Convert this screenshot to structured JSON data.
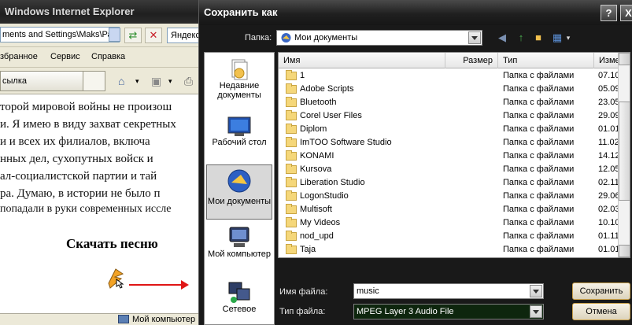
{
  "ie": {
    "title": "Windows Internet Explorer",
    "address": "ments and Settings\\Maks\\Ра",
    "search_text": "Яндекс",
    "menu": [
      "збранное",
      "Сервис",
      "Справка"
    ],
    "tab_label": "сылка",
    "content_lines": [
      "торой мировой войны не произош",
      "и.  Я имею в виду захват секретных",
      "и  и  всех  их  филиалов,  включа",
      "нных  дел,  сухопутных  войск  и",
      "ал-социалистской  партии  и  тай",
      "ра.  Думаю,  в  истории  не  было  п",
      "попадали в руки современных иссле"
    ],
    "heading": "Скачать песню",
    "status": "Мой компьютер"
  },
  "dialog": {
    "title": "Сохранить как",
    "help_label": "?",
    "close_label": "X",
    "folder_label": "Папка:",
    "folder_value": "Мои документы",
    "places": [
      {
        "label": "Недавние документы",
        "icon": "recent-documents-icon"
      },
      {
        "label": "Рабочий стол",
        "icon": "desktop-icon"
      },
      {
        "label": "Мои документы",
        "icon": "my-documents-icon"
      },
      {
        "label": "Мой компьютер",
        "icon": "my-computer-icon"
      },
      {
        "label": "Сетевое",
        "icon": "network-icon"
      }
    ],
    "columns": [
      "Имя",
      "Размер",
      "Тип",
      "Изме"
    ],
    "files": [
      {
        "name": "1",
        "type": "Папка с файлами",
        "date": "07.10"
      },
      {
        "name": "Adobe Scripts",
        "type": "Папка с файлами",
        "date": "05.09"
      },
      {
        "name": "Bluetooth",
        "type": "Папка с файлами",
        "date": "23.05"
      },
      {
        "name": "Corel User Files",
        "type": "Папка с файлами",
        "date": "29.09"
      },
      {
        "name": "Diplom",
        "type": "Папка с файлами",
        "date": "01.01"
      },
      {
        "name": "ImTOO Software Studio",
        "type": "Папка с файлами",
        "date": "11.02"
      },
      {
        "name": "KONAMI",
        "type": "Папка с файлами",
        "date": "14.12"
      },
      {
        "name": "Kursova",
        "type": "Папка с файлами",
        "date": "12.05"
      },
      {
        "name": "Liberation Studio",
        "type": "Папка с файлами",
        "date": "02.11"
      },
      {
        "name": "LogonStudio",
        "type": "Папка с файлами",
        "date": "29.06"
      },
      {
        "name": "Multisoft",
        "type": "Папка с файлами",
        "date": "02.03"
      },
      {
        "name": "My Videos",
        "type": "Папка с файлами",
        "date": "10.10"
      },
      {
        "name": "nod_upd",
        "type": "Папка с файлами",
        "date": "01.11"
      },
      {
        "name": "Taja",
        "type": "Папка с файлами",
        "date": "01.01"
      }
    ],
    "filename_label": "Имя файла:",
    "filename_value": "music",
    "filetype_label": "Тип файла:",
    "filetype_value": "MPEG Layer 3 Audio File",
    "save_label": "Сохранить",
    "cancel_label": "Отмена"
  },
  "colors": {
    "dialog_bg": "#191919",
    "accent_button_border": "#caa14b",
    "arrow": "#e01616"
  }
}
